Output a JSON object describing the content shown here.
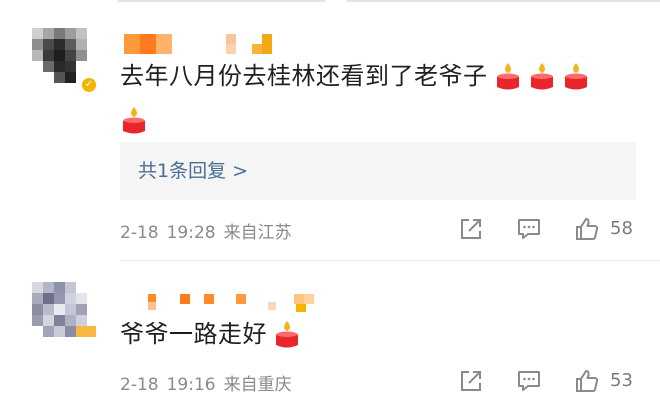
{
  "comments": [
    {
      "text": "去年八月份去桂林还看到了老爷子",
      "emoji_name": "candle-emoji",
      "emoji_count": 4,
      "reply_label": "共1条回复 >",
      "date": "2-18",
      "time": "19:28",
      "location": "来自江苏",
      "likes": "58",
      "verified": true
    },
    {
      "text": "爷爷一路走好",
      "emoji_name": "candle-emoji",
      "emoji_count": 1,
      "date": "2-18",
      "time": "19:16",
      "location": "来自重庆",
      "likes": "53",
      "verified": false
    }
  ],
  "icons": {
    "share": "share-icon",
    "comment": "comment-icon",
    "like": "thumbs-up-icon"
  },
  "colors": {
    "link": "#4a6e92",
    "meta": "#8a8a8a",
    "reply_bg": "#f5f5f5",
    "badge": "#f5b400",
    "candle": "#e8262c",
    "flame": "#f7b21b"
  }
}
